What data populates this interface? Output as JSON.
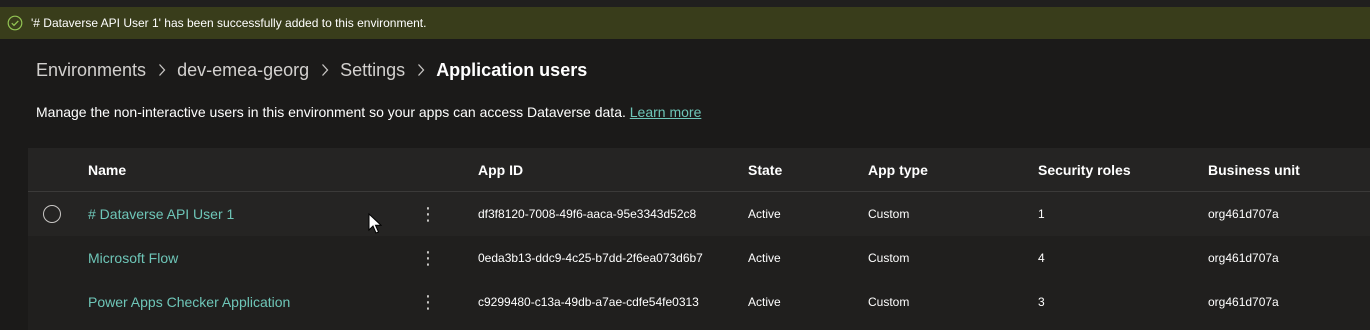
{
  "banner": {
    "message": "'# Dataverse API User 1' has been successfully added to this environment."
  },
  "breadcrumb": {
    "items": [
      "Environments",
      "dev-emea-georg",
      "Settings"
    ],
    "current": "Application users"
  },
  "description": {
    "text": "Manage the non-interactive users in this environment so your apps can access Dataverse data.",
    "link": "Learn more"
  },
  "table": {
    "headers": {
      "name": "Name",
      "app_id": "App ID",
      "state": "State",
      "app_type": "App type",
      "security_roles": "Security roles",
      "business_unit": "Business unit"
    },
    "rows": [
      {
        "name": "# Dataverse API User 1",
        "app_id": "df3f8120-7008-49f6-aaca-95e3343d52c8",
        "state": "Active",
        "app_type": "Custom",
        "security_roles": "1",
        "business_unit": "org461d707a",
        "more": "⋮"
      },
      {
        "name": "Microsoft Flow",
        "app_id": "0eda3b13-ddc9-4c25-b7dd-2f6ea073d6b7",
        "state": "Active",
        "app_type": "Custom",
        "security_roles": "4",
        "business_unit": "org461d707a",
        "more": "⋮"
      },
      {
        "name": "Power Apps Checker Application",
        "app_id": "c9299480-c13a-49db-a7ae-cdfe54fe0313",
        "state": "Active",
        "app_type": "Custom",
        "security_roles": "3",
        "business_unit": "org461d707a",
        "more": "⋮"
      }
    ]
  },
  "colors": {
    "banner_bg": "#393d1b",
    "link": "#6ec6b8",
    "success_icon": "#92c353"
  }
}
